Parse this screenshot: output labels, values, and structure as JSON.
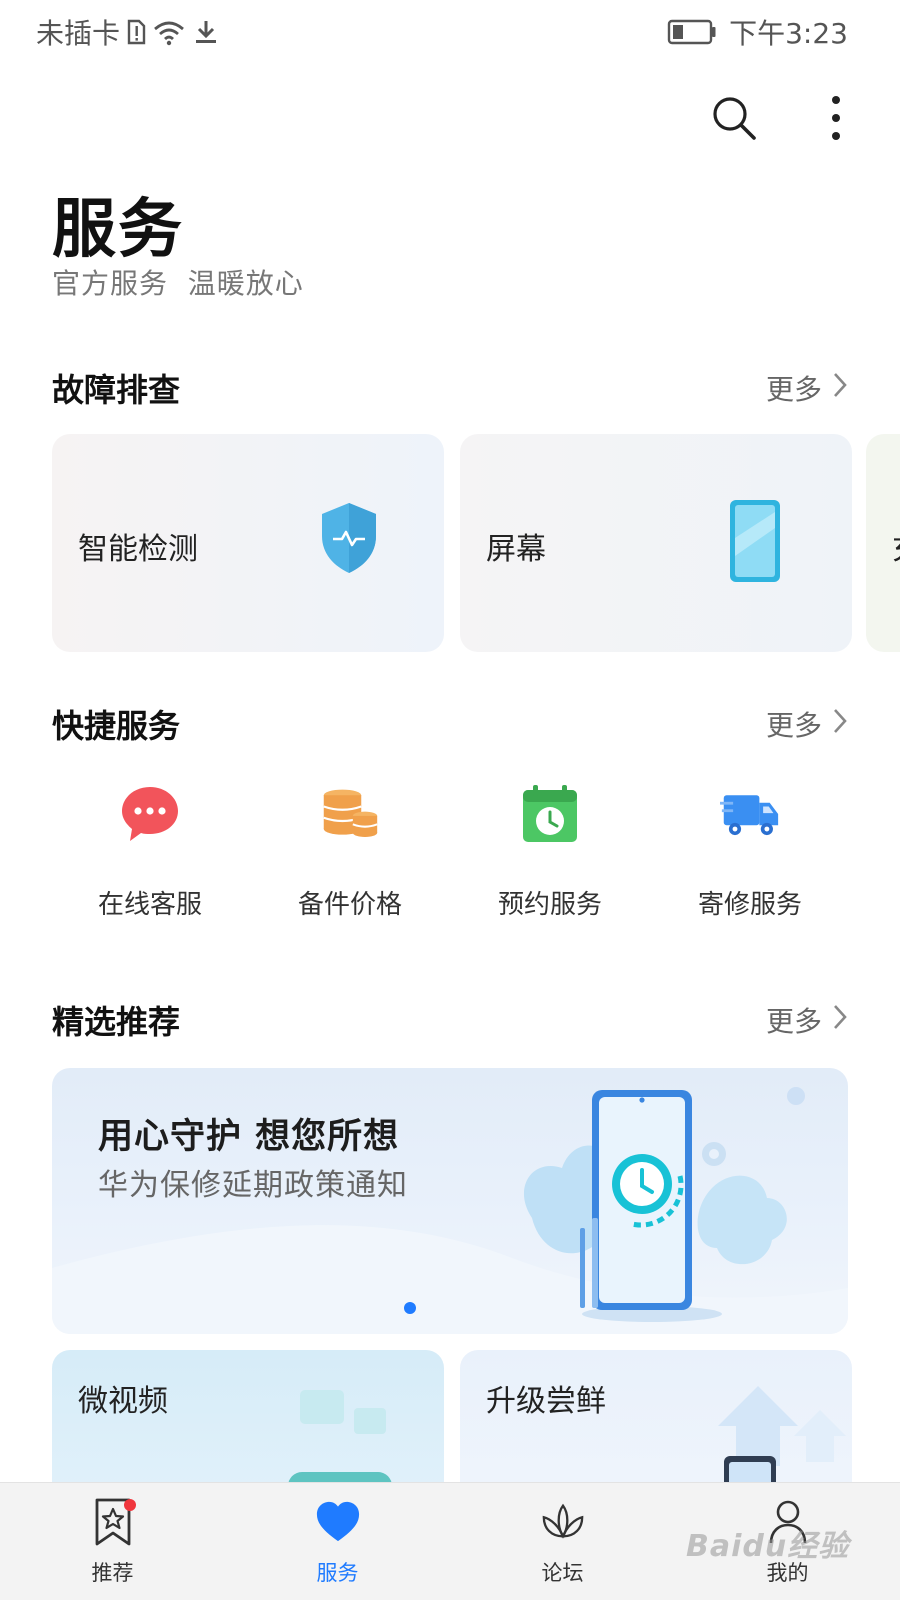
{
  "status_bar": {
    "carrier": "未插卡",
    "time": "下午3:23",
    "icons": [
      "sim-alert-icon",
      "wifi-icon",
      "download-icon",
      "battery-icon"
    ]
  },
  "header": {
    "title": "服务",
    "subtitle": "官方服务  温暖放心",
    "actions": [
      "search-icon",
      "more-vertical-icon"
    ]
  },
  "troubleshooting": {
    "title": "故障排查",
    "more_label": "更多",
    "cards": [
      {
        "label": "智能检测",
        "icon": "shield-check-icon"
      },
      {
        "label": "屏幕",
        "icon": "phone-screen-icon"
      },
      {
        "label": "充",
        "icon": ""
      }
    ]
  },
  "quick_services": {
    "title": "快捷服务",
    "more_label": "更多",
    "items": [
      {
        "label": "在线客服",
        "icon": "chat-bubble-icon"
      },
      {
        "label": "备件价格",
        "icon": "coins-icon"
      },
      {
        "label": "预约服务",
        "icon": "calendar-clock-icon"
      },
      {
        "label": "寄修服务",
        "icon": "delivery-truck-icon"
      }
    ]
  },
  "featured": {
    "title": "精选推荐",
    "more_label": "更多",
    "banner": {
      "title": "用心守护 想您所想",
      "subtitle": "华为保修延期政策通知"
    },
    "cards": [
      {
        "label": "微视频"
      },
      {
        "label": "升级尝鲜"
      }
    ]
  },
  "bottom_nav": {
    "active": "服务",
    "items": [
      {
        "label": "推荐",
        "icon": "bookmark-star-icon",
        "badge": true
      },
      {
        "label": "服务",
        "icon": "heart-icon",
        "badge": false
      },
      {
        "label": "论坛",
        "icon": "lotus-icon",
        "badge": false
      },
      {
        "label": "我的",
        "icon": "person-icon",
        "badge": false
      }
    ]
  },
  "watermark": "Baidu经验",
  "colors": {
    "accent": "#1f7bff",
    "badge": "#f0363d",
    "chat": "#f2545b",
    "coins": "#f0a04b",
    "calendar": "#4cc764",
    "truck": "#3a8ff2"
  }
}
